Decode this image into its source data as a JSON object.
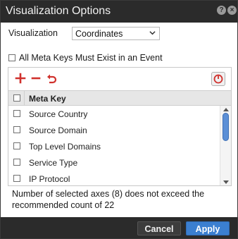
{
  "dialog": {
    "title": "Visualization Options"
  },
  "visualization": {
    "label": "Visualization",
    "selected": "Coordinates"
  },
  "all_meta_keys": {
    "label": "All Meta Keys Must Exist in an Event"
  },
  "grid": {
    "header": "Meta Key",
    "rows": [
      {
        "label": "Source Country"
      },
      {
        "label": "Source Domain"
      },
      {
        "label": "Top Level Domains"
      },
      {
        "label": "Service Type"
      },
      {
        "label": "IP Protocol"
      }
    ]
  },
  "message": "Number of selected axes (8) does not exceed the recommended count of 22",
  "footer": {
    "cancel_label": "Cancel",
    "apply_label": "Apply"
  },
  "colors": {
    "titlebar": "#2b2b2b",
    "accent": "#3b7fd0",
    "toolbar_red": "#d0312d"
  },
  "icons": {
    "add": "plus-icon",
    "remove": "minus-icon",
    "undo": "undo-icon",
    "reset": "reset-icon",
    "help": "help-icon",
    "close": "close-icon"
  }
}
